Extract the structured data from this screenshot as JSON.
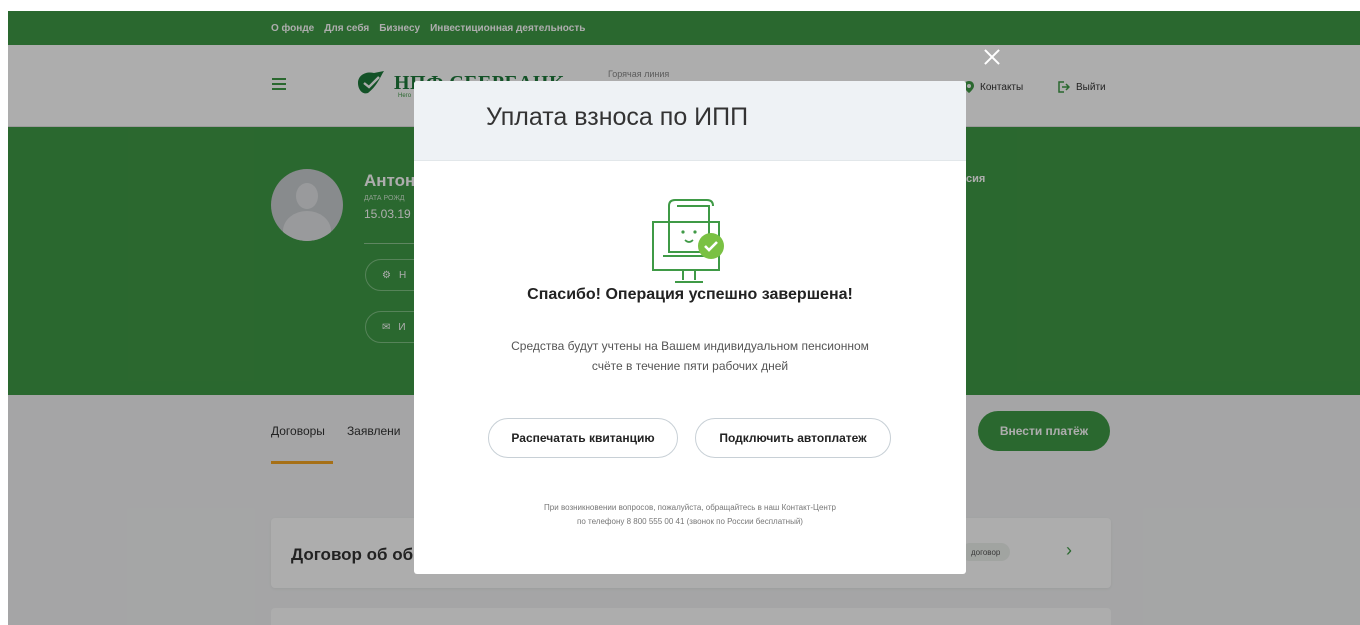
{
  "topnav": {
    "items": [
      "О фонде",
      "Для себя",
      "Бизнесу",
      "Инвестиционная деятельность"
    ]
  },
  "header": {
    "logo_name": "НПФ СБЕРБАНК",
    "logo_sub": "Него",
    "hotline_label": "Горячая линия",
    "contacts_label": "Контакты",
    "logout_label": "Выйти"
  },
  "hero": {
    "user_name": "Антон",
    "dob_label": "ДАТА РОЖД",
    "dob_value": "15.03.19",
    "pill1_label": "Н",
    "pill2_label": "И",
    "right_text": "сия"
  },
  "tabs": [
    "Договоры",
    "Заявлени"
  ],
  "pay_button": "Внести платёж",
  "card": {
    "title": "Договор об об",
    "badge": "договор"
  },
  "modal": {
    "title": "Уплата взноса по ИПП",
    "success": "Спасибо! Операция успешно завершена!",
    "message_line1": "Средства будут учтены на Вашем индивидуальном пенсионном",
    "message_line2": "счёте в течение пяти рабочих дней",
    "print_button": "Распечатать квитанцию",
    "autopay_button": "Подключить автоплатеж",
    "footer_line1": "При возникновении вопросов, пожалуйста, обращайтесь в наш Контакт-Центр",
    "footer_line2": "по телефону 8 800 555 00 41 (звонок по России бесплатный)"
  },
  "colors": {
    "brand_green": "#3f9a46",
    "accent_orange": "#f5a623",
    "success_green": "#7ac143"
  }
}
